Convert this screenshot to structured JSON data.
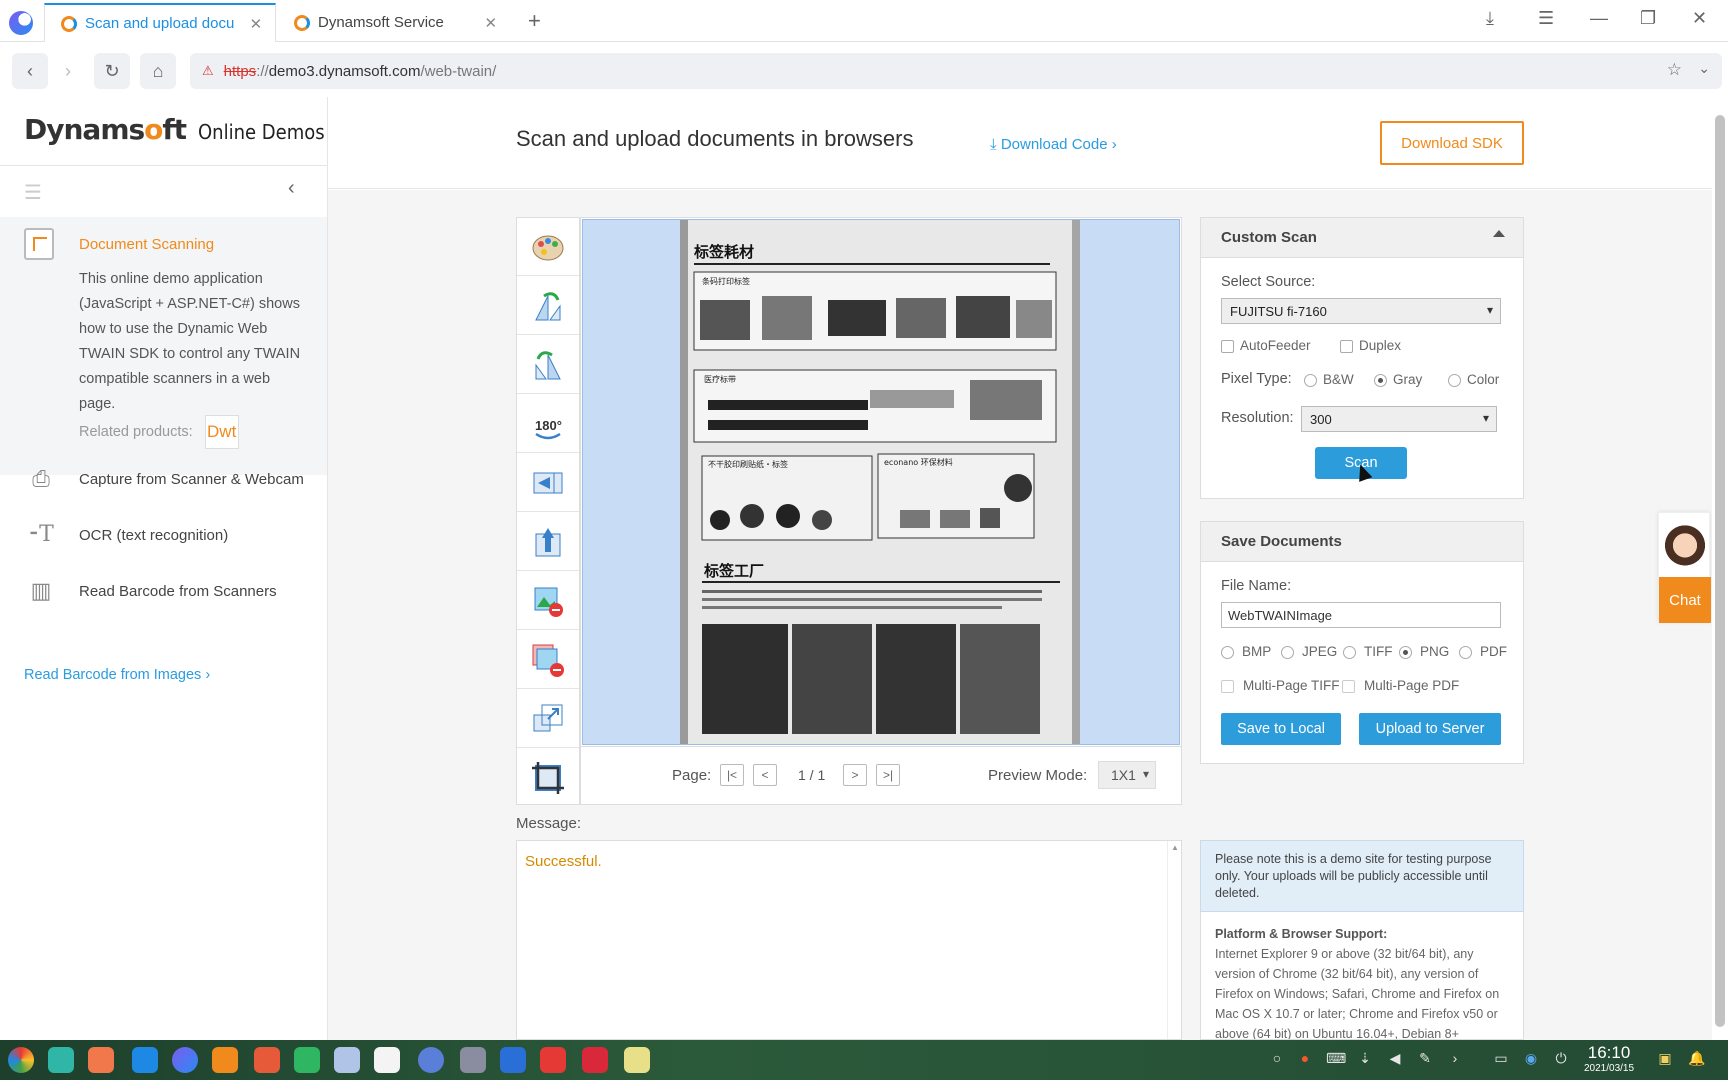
{
  "browser": {
    "tabs": [
      {
        "title": "Scan and upload docu",
        "active": true
      },
      {
        "title": "Dynamsoft Service",
        "active": false
      }
    ],
    "url": {
      "scheme": "https",
      "sep": "://",
      "host": "demo3.dynamsoft.com",
      "path": "/web-twain/"
    }
  },
  "sidebar": {
    "brand_logo_a": "Dynams",
    "brand_logo_o": "o",
    "brand_logo_b": "ft",
    "brand_sub": "Online Demos",
    "active_item": {
      "title": "Document Scanning",
      "description": "This online demo application (JavaScript + ASP.NET-C#) shows how to use the Dynamic Web TWAIN SDK to control any TWAIN compatible scanners in a web page.",
      "related_label": "Related products:",
      "related_badge": "Dwt"
    },
    "items": [
      {
        "label": "Capture from Scanner & Webcam",
        "icon": "camera-scanner-icon"
      },
      {
        "label": "OCR (text recognition)",
        "icon": "ocr-icon"
      },
      {
        "label": "Read Barcode from Scanners",
        "icon": "barcode-scanner-icon"
      }
    ],
    "link": "Read Barcode from Images ›"
  },
  "header": {
    "title": "Scan and upload documents in browsers",
    "download_code": "Download Code ›",
    "download_sdk": "Download SDK"
  },
  "viewer": {
    "tools": [
      "color-palette-icon",
      "rotate-left-icon",
      "rotate-right-icon",
      "rotate-180-icon",
      "mirror-icon",
      "flip-icon",
      "remove-selected-icon",
      "remove-all-icon",
      "change-size-icon",
      "crop-icon"
    ],
    "page_label": "Page:",
    "pager_buttons": [
      "|<",
      "<",
      ">",
      ">|"
    ],
    "page_count": "1 / 1",
    "preview_label": "Preview Mode:",
    "preview_value": "1X1",
    "document": {
      "heading1": "标签耗材",
      "heading2": "标签工厂",
      "section_a": "条码打印标签",
      "section_b": "医疗标带",
      "section_c": "不干胶印刷贴纸・标签",
      "section_d": "econano 环保材料"
    }
  },
  "message": {
    "label": "Message:",
    "text": "Successful."
  },
  "custom_scan": {
    "title": "Custom Scan",
    "source_label": "Select Source:",
    "source_value": "FUJITSU fi-7160",
    "autofeeder": "AutoFeeder",
    "duplex": "Duplex",
    "pixel_label": "Pixel Type:",
    "pixel_options": [
      "B&W",
      "Gray",
      "Color"
    ],
    "pixel_selected": "Gray",
    "resolution_label": "Resolution:",
    "resolution_value": "300",
    "scan_button": "Scan"
  },
  "save_docs": {
    "title": "Save Documents",
    "filename_label": "File Name:",
    "filename_value": "WebTWAINImage",
    "formats": [
      "BMP",
      "JPEG",
      "TIFF",
      "PNG",
      "PDF"
    ],
    "format_selected": "PNG",
    "multi_tiff": "Multi-Page TIFF",
    "multi_pdf": "Multi-Page PDF",
    "save_local": "Save to Local",
    "upload": "Upload to Server"
  },
  "notice": "Please note this is a demo site for testing purpose only. Your uploads will be publicly accessible until deleted.",
  "support": {
    "title": "Platform & Browser Support:",
    "text": "Internet Explorer 9 or above (32 bit/64 bit), any version of Chrome (32 bit/64 bit), any version of Firefox on Windows; Safari, Chrome and Firefox on Mac OS X 10.7 or later; Chrome and Firefox v50 or above (64 bit) on Ubuntu 16.04+, Debian 8+"
  },
  "chat": "Chat",
  "taskbar": {
    "time": "16:10",
    "date": "2021/03/15"
  },
  "colors": {
    "accent_orange": "#f08a1c",
    "accent_blue": "#2d9cdb",
    "link_blue": "#2a9ce0",
    "success_text": "#d48a00"
  }
}
